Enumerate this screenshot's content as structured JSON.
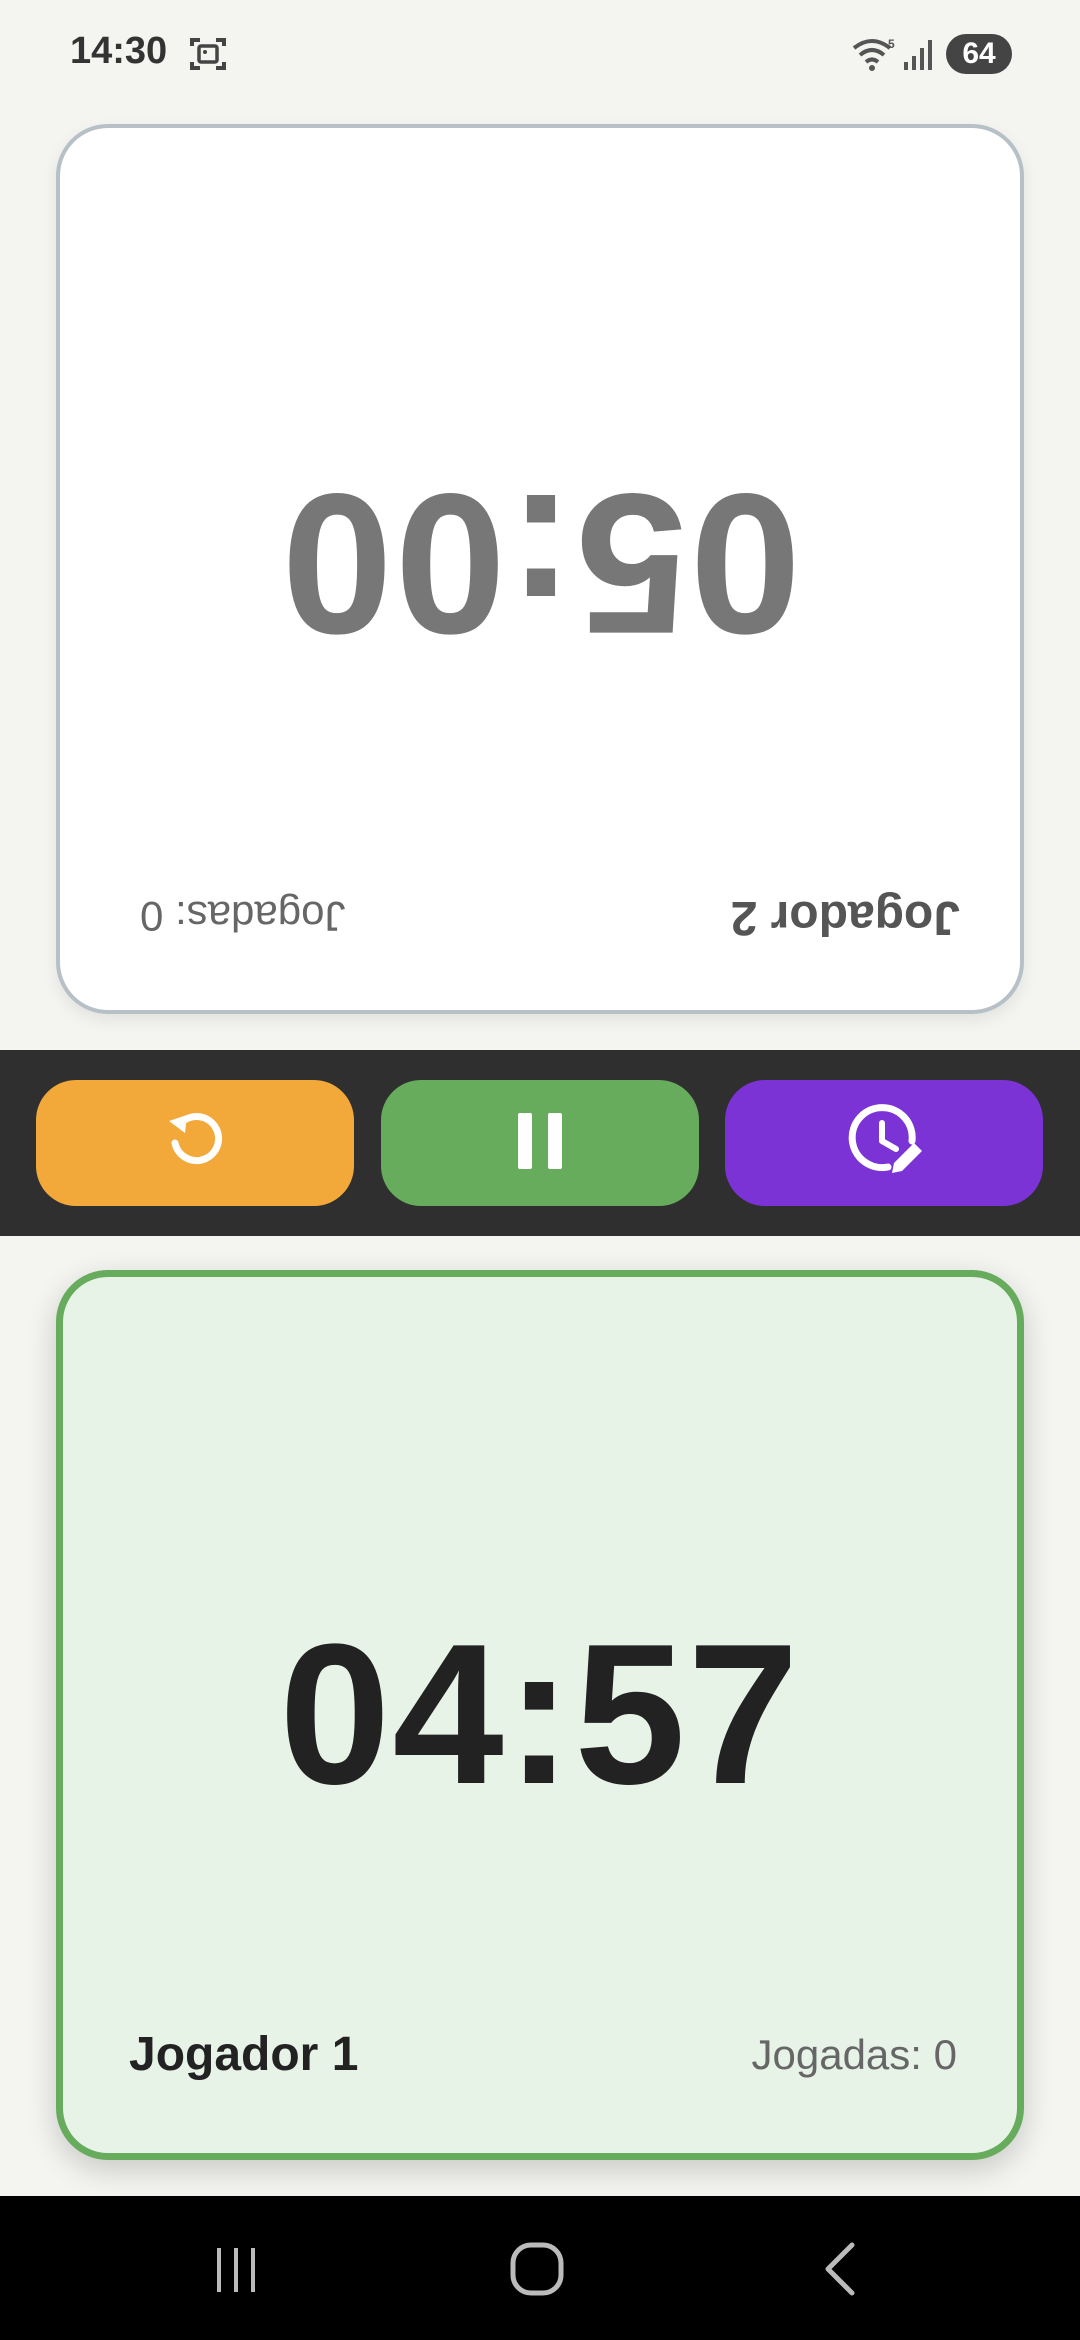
{
  "status_bar": {
    "time": "14:30",
    "battery": "64",
    "icons": [
      "screenshot-icon",
      "wifi-icon",
      "signal-icon",
      "battery-icon"
    ]
  },
  "player2": {
    "name": "Jogador 2",
    "moves": "Jogadas: 0",
    "time": "05:00",
    "state": "inactive"
  },
  "player1": {
    "name": "Jogador 1",
    "moves": "Jogadas: 0",
    "time": "04:57",
    "state": "active"
  },
  "controls": [
    {
      "name": "reset",
      "icon": "reset-icon",
      "color": "#f2a93a"
    },
    {
      "name": "pause",
      "icon": "pause-icon",
      "color": "#66ac5c"
    },
    {
      "name": "edit-time",
      "icon": "clock-edit-icon",
      "color": "#7c33d6"
    }
  ],
  "nav": {
    "icons": [
      "recent-apps-icon",
      "home-icon",
      "back-icon"
    ]
  },
  "colors": {
    "active_border": "#66ac5c",
    "active_bg": "#e8f3e8",
    "inactive_border": "#b6c0c6",
    "control_bar": "#2f2f2f"
  }
}
